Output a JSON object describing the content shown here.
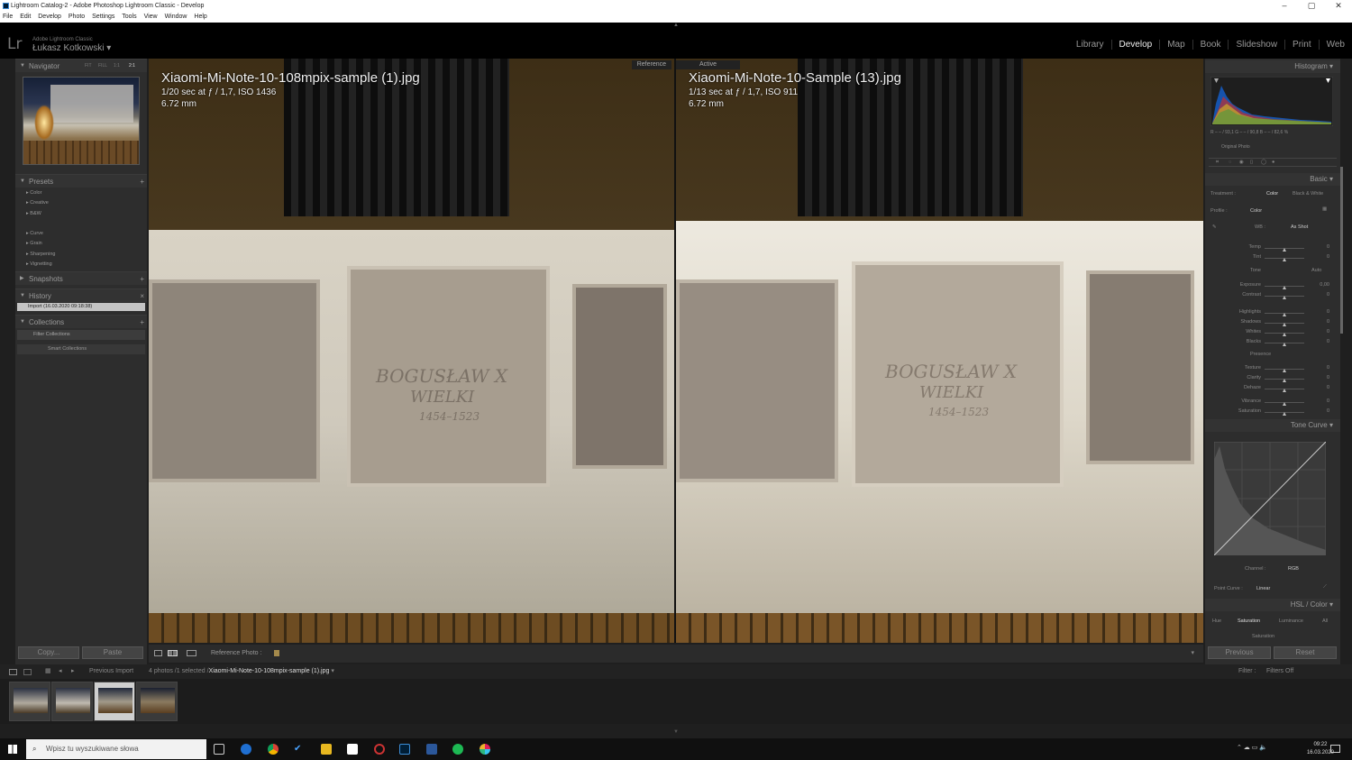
{
  "window": {
    "title": "Lightroom Catalog-2 - Adobe Photoshop Lightroom Classic - Develop",
    "minimize": "–",
    "maximize": "▢",
    "close": "✕"
  },
  "menu": [
    "File",
    "Edit",
    "Develop",
    "Photo",
    "Settings",
    "Tools",
    "View",
    "Window",
    "Help"
  ],
  "identity": {
    "logo": "Lr",
    "line1": "Adobe Lightroom Classic",
    "user": "Łukasz Kotkowski",
    "user_caret": "▾"
  },
  "modules": [
    "Library",
    "Develop",
    "Map",
    "Book",
    "Slideshow",
    "Print",
    "Web"
  ],
  "active_module": "Develop",
  "left": {
    "navigator": "Navigator",
    "nav_zoom": [
      "FIT",
      "FILL",
      "1:1",
      "2:1"
    ],
    "presets": "Presets",
    "preset_items": [
      "Color",
      "Creative",
      "B&W",
      "Curve",
      "Grain",
      "Sharpening",
      "Vignetting"
    ],
    "snapshots": "Snapshots",
    "history": "History",
    "history_item": "Import (16.03.2020 09:18:38)",
    "collections": "Collections",
    "filter_collections": "Filter Collections",
    "smart_collections": "Smart Collections",
    "copy": "Copy...",
    "paste": "Paste"
  },
  "viewer": {
    "reference_label": "Reference",
    "active_label": "Active",
    "left_photo": {
      "name": "Xiaomi-Mi-Note-10-108mpix-sample (1).jpg",
      "exposure": "1/20 sec at ƒ / 1,7, ISO 1436",
      "focal": "6.72 mm"
    },
    "right_photo": {
      "name": "Xiaomi-Mi-Note-10-Sample (13).jpg",
      "exposure": "1/13 sec at ƒ / 1,7, ISO 911",
      "focal": "6.72 mm"
    },
    "plaque_title": "BOGUSŁAW X",
    "plaque_sub": "WIELKI",
    "plaque_years": "1454–1523"
  },
  "toolbar": {
    "reference_photo": "Reference Photo :"
  },
  "right": {
    "histogram": "Histogram",
    "hist_readout": "R  – – / 93,1   G  – – / 90,8   B  – – / 82,6  %",
    "original_photo": "Original Photo",
    "basic": "Basic",
    "treatment": "Treatment :",
    "color": "Color",
    "bw": "Black & White",
    "profile": "Profile :",
    "profile_val": "Color",
    "wb": "WB :",
    "wb_val": "As Shot",
    "tone": "Tone",
    "auto": "Auto",
    "presence": "Presence",
    "sliders": [
      {
        "label": "Temp",
        "value": "0"
      },
      {
        "label": "Tint",
        "value": "0"
      },
      {
        "label": "Exposure",
        "value": "0,00"
      },
      {
        "label": "Contrast",
        "value": "0"
      },
      {
        "label": "Highlights",
        "value": "0"
      },
      {
        "label": "Shadows",
        "value": "0"
      },
      {
        "label": "Whites",
        "value": "0"
      },
      {
        "label": "Blacks",
        "value": "0"
      },
      {
        "label": "Texture",
        "value": "0"
      },
      {
        "label": "Clarity",
        "value": "0"
      },
      {
        "label": "Dehaze",
        "value": "0"
      },
      {
        "label": "Vibrance",
        "value": "0"
      },
      {
        "label": "Saturation",
        "value": "0"
      }
    ],
    "tone_curve": "Tone Curve",
    "channel": "Channel :",
    "channel_val": "RGB",
    "point_curve": "Point Curve :",
    "point_curve_val": "Linear",
    "hsl": "HSL",
    "hsl_color": "Color",
    "hsl_tabs": [
      "Hue",
      "Saturation",
      "Luminance",
      "All"
    ],
    "saturation": "Saturation",
    "previous": "Previous",
    "reset": "Reset"
  },
  "filmbar": {
    "source": "Previous Import",
    "count": "4 photos /1 selected /",
    "file": "Xiaomi-Mi-Note-10-108mpix-sample (1).jpg",
    "filter": "Filter :",
    "filter_val": "Filters Off"
  },
  "taskbar": {
    "search_placeholder": "Wpisz tu wyszukiwane słowa",
    "time": "09:22",
    "date": "16.03.2020"
  }
}
